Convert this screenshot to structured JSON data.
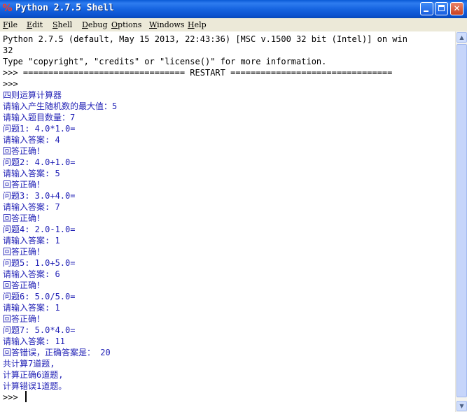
{
  "window": {
    "title": "Python 2.7.5 Shell",
    "icon": "python-idle-icon",
    "controls": {
      "minimize": "minimize-icon",
      "maximize": "maximize-icon",
      "close": "✕"
    }
  },
  "menu": [
    "File",
    "Edit",
    "Shell",
    "Debug",
    "Options",
    "Windows",
    "Help"
  ],
  "shell": {
    "header": [
      "Python 2.7.5 (default, May 15 2013, 22:43:36) [MSC v.1500 32 bit (Intel)] on win",
      "32",
      "Type \"copyright\", \"credits\" or \"license()\" for more information.",
      ">>> ================================ RESTART ================================",
      ">>> "
    ],
    "output": [
      "四则运算计算器",
      "请输入产生随机数的最大值：5",
      "请输入题目数量：7",
      "问题1: 4.0*1.0=",
      "请输入答案: 4",
      "回答正确！",
      "问题2: 4.0+1.0=",
      "请输入答案: 5",
      "回答正确！",
      "问题3: 3.0+4.0=",
      "请输入答案: 7",
      "回答正确！",
      "问题4: 2.0-1.0=",
      "请输入答案: 1",
      "回答正确！",
      "问题5: 1.0+5.0=",
      "请输入答案: 6",
      "回答正确！",
      "问题6: 5.0/5.0=",
      "请输入答案: 1",
      "回答正确！",
      "问题7: 5.0*4.0=",
      "请输入答案: 11",
      "回答错误，正确答案是： 20",
      "共计算7道题,",
      "计算正确6道题,",
      "计算错误1道题。"
    ],
    "prompt": ">>> "
  },
  "colors": {
    "stdout": "#1f1fb5",
    "titlebar": "#1664e0",
    "close": "#c9401f"
  }
}
